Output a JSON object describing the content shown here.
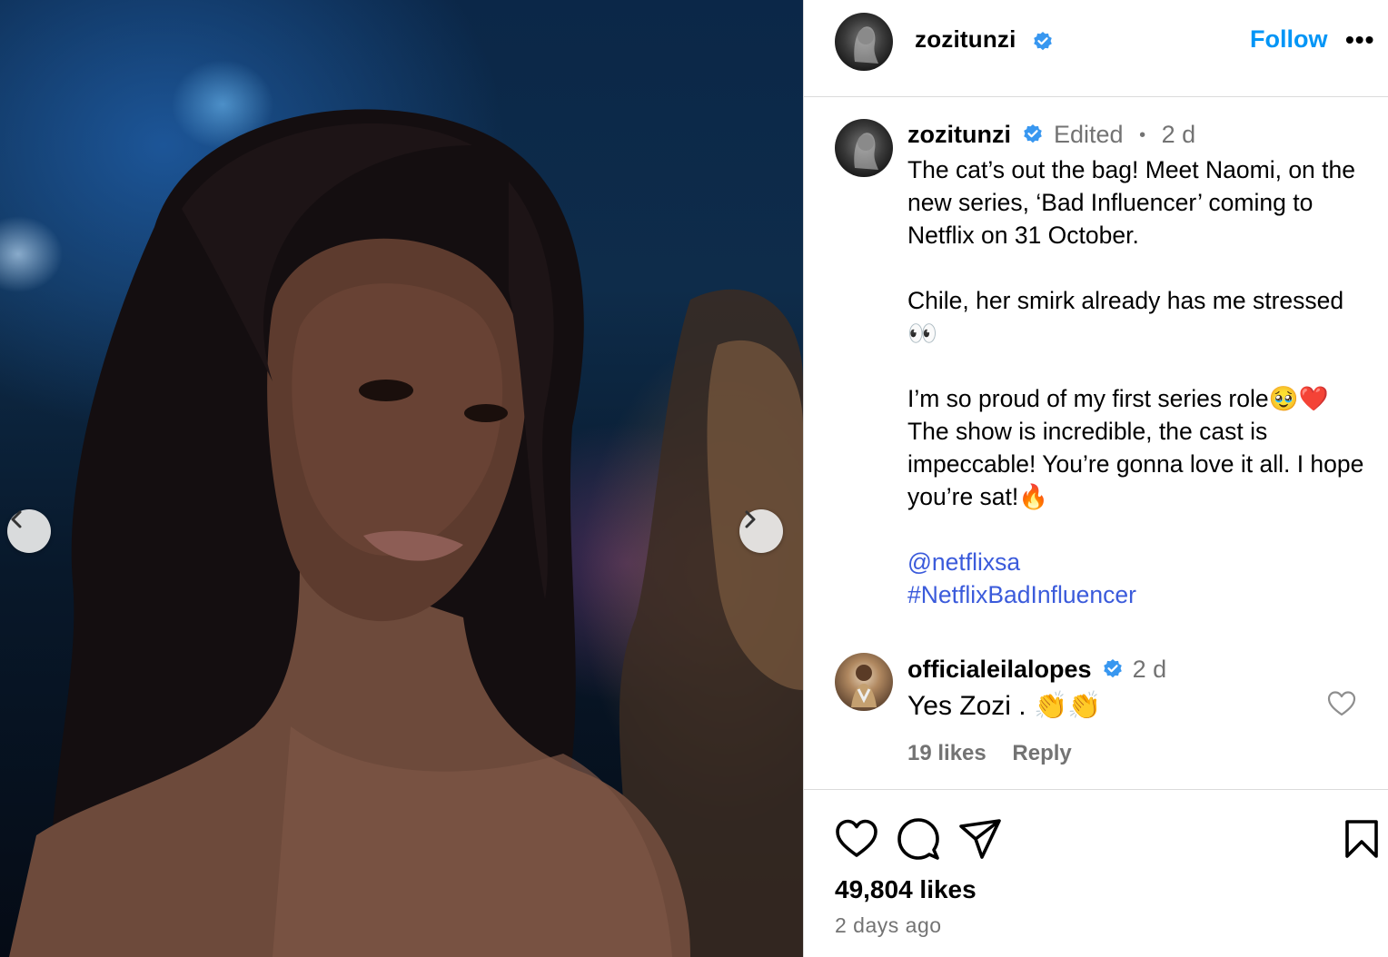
{
  "post": {
    "username": "zozitunzi",
    "follow_label": "Follow",
    "more_label": "•••",
    "edited_label": "Edited",
    "separator": "•",
    "time_short": "2 d",
    "caption_line1": "The cat’s out the bag! Meet Naomi, on the new series, ‘Bad Influencer’ coming to Netflix on 31 October.",
    "caption_line2": "Chile, her smirk already has me stressed 👀",
    "caption_line3": "I’m so proud of my first series role🥹❤️ The show is incredible, the cast is impeccable! You’re gonna love it all. I hope you’re sat!🔥",
    "mention": "@netflixsa",
    "hashtag": "#NetflixBadInfluencer"
  },
  "comment": {
    "username": "officialeilalopes",
    "time_short": "2 d",
    "text": "Yes Zozi . 👏👏",
    "likes_label": "19 likes",
    "reply_label": "Reply"
  },
  "footer": {
    "likes": "49,804 likes",
    "time_ago": "2 days ago"
  },
  "icons": [
    "chevron-left-icon",
    "chevron-right-icon",
    "verified-icon",
    "heart-icon",
    "comment-icon",
    "share-icon",
    "bookmark-icon",
    "more-icon"
  ],
  "colors": {
    "accent": "#0095f6",
    "link": "#385898",
    "muted": "#737373",
    "verified": "#3897f0"
  }
}
